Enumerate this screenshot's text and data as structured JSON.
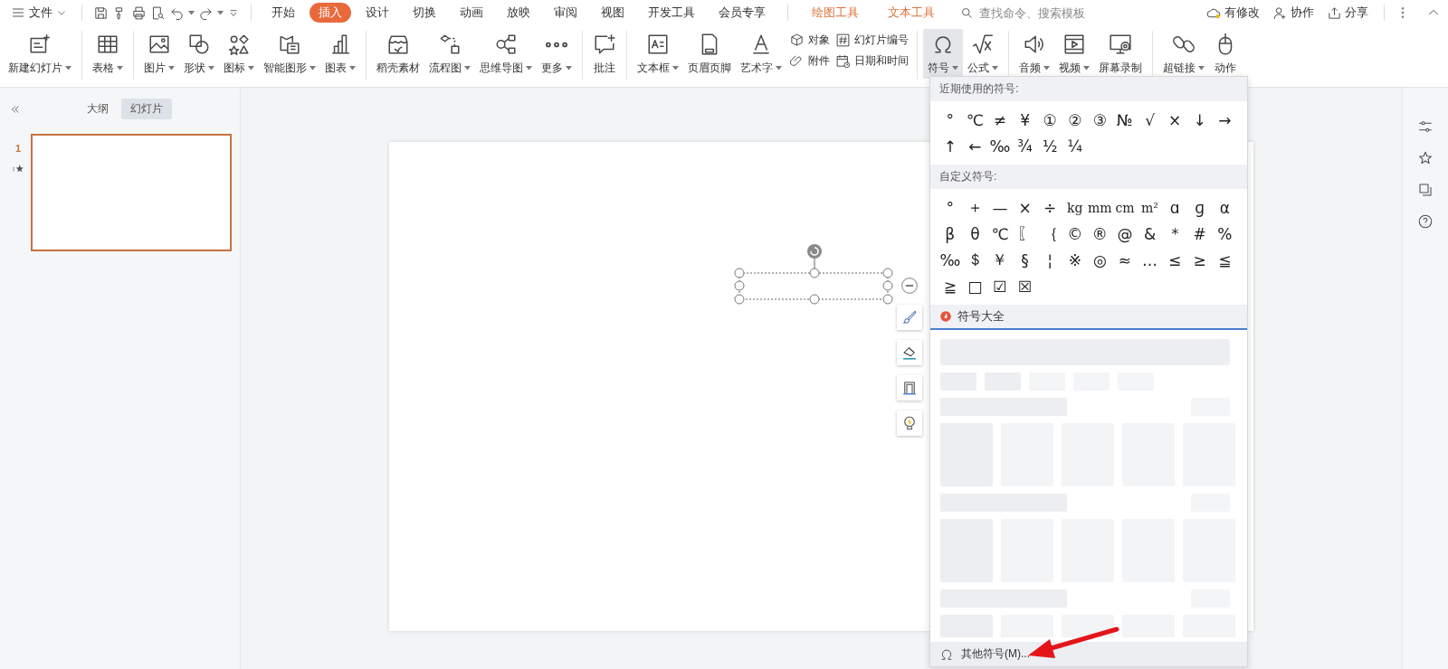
{
  "title_bar": {
    "file_menu": "文件",
    "tabs": [
      {
        "label": "开始",
        "selected": false
      },
      {
        "label": "插入",
        "selected": true
      },
      {
        "label": "设计",
        "selected": false
      },
      {
        "label": "切换",
        "selected": false
      },
      {
        "label": "动画",
        "selected": false
      },
      {
        "label": "放映",
        "selected": false
      },
      {
        "label": "审阅",
        "selected": false
      },
      {
        "label": "视图",
        "selected": false
      },
      {
        "label": "开发工具",
        "selected": false
      },
      {
        "label": "会员专享",
        "selected": false
      }
    ],
    "context_tabs": [
      "绘图工具",
      "文本工具"
    ],
    "search": {
      "placeholder": "查找命令、搜索模板"
    },
    "actions": [
      "有修改",
      "协作",
      "分享"
    ]
  },
  "ribbon": {
    "groups": [
      [
        {
          "kind": "large",
          "label": "新建幻灯片",
          "dropdown": true,
          "open": false
        }
      ],
      [
        {
          "kind": "large",
          "label": "表格",
          "dropdown": true,
          "open": false
        }
      ],
      [
        {
          "kind": "large",
          "label": "图片",
          "dropdown": true,
          "open": false
        },
        {
          "kind": "large",
          "label": "形状",
          "dropdown": true,
          "open": false
        },
        {
          "kind": "large",
          "label": "图标",
          "dropdown": true,
          "open": false
        },
        {
          "kind": "large",
          "label": "智能图形",
          "dropdown": true,
          "open": false
        },
        {
          "kind": "large",
          "label": "图表",
          "dropdown": true,
          "open": false
        }
      ],
      [
        {
          "kind": "large",
          "label": "稻壳素材",
          "dropdown": false,
          "open": false
        },
        {
          "kind": "large",
          "label": "流程图",
          "dropdown": true,
          "open": false
        },
        {
          "kind": "large",
          "label": "思维导图",
          "dropdown": true,
          "open": false
        },
        {
          "kind": "large",
          "label": "更多",
          "dropdown": true,
          "open": false
        }
      ],
      [
        {
          "kind": "large",
          "label": "批注",
          "dropdown": false,
          "open": false
        }
      ],
      [
        {
          "kind": "large",
          "label": "文本框",
          "dropdown": true,
          "open": false
        },
        {
          "kind": "large",
          "label": "页眉页脚",
          "dropdown": false,
          "open": false
        },
        {
          "kind": "large",
          "label": "艺术字",
          "dropdown": true,
          "open": false
        },
        {
          "kind": "stack",
          "items": [
            "对象",
            "附件"
          ]
        },
        {
          "kind": "stack",
          "items": [
            "幻灯片编号",
            "日期和时间"
          ]
        }
      ],
      [
        {
          "kind": "large",
          "label": "符号",
          "dropdown": true,
          "open": true
        },
        {
          "kind": "large",
          "label": "公式",
          "dropdown": true,
          "open": false
        }
      ],
      [
        {
          "kind": "large",
          "label": "音频",
          "dropdown": true,
          "open": false
        },
        {
          "kind": "large",
          "label": "视频",
          "dropdown": true,
          "open": false
        },
        {
          "kind": "large",
          "label": "屏幕录制",
          "dropdown": false,
          "open": false
        }
      ],
      [
        {
          "kind": "large",
          "label": "超链接",
          "dropdown": true,
          "open": false
        },
        {
          "kind": "large",
          "label": "动作",
          "dropdown": false,
          "open": false
        }
      ]
    ]
  },
  "slide_panel": {
    "tabs": [
      {
        "label": "大纲",
        "selected": false
      },
      {
        "label": "幻灯片",
        "selected": true
      }
    ],
    "slides": [
      {
        "number": "1",
        "selected": true
      }
    ]
  },
  "symbol_panel": {
    "sections": [
      {
        "title": "近期使用的符号:",
        "symbols": [
          "°",
          "℃",
          "≠",
          "¥",
          "①",
          "②",
          "③",
          "№",
          "√",
          "×",
          "↓",
          "→",
          "↑",
          "←",
          "‰",
          "¾",
          "½",
          "¼"
        ]
      },
      {
        "title": "自定义符号:",
        "symbols": [
          "°",
          "＋",
          "—",
          "×",
          "÷",
          "kg",
          "mm",
          "cm",
          "m²",
          "ɑ",
          "ɡ",
          "α",
          "β",
          "θ",
          "℃",
          "〖",
          "｛",
          "©",
          "®",
          "@",
          "&",
          "＊",
          "#",
          "%",
          "‰",
          "＄",
          "￥",
          "§",
          "¦",
          "※",
          "◎",
          "≈",
          "…",
          "≤",
          "≥",
          "≦",
          "≧",
          "□",
          "☑",
          "☒"
        ]
      }
    ],
    "library_tab": "符号大全",
    "footer": "其他符号(M)..."
  }
}
